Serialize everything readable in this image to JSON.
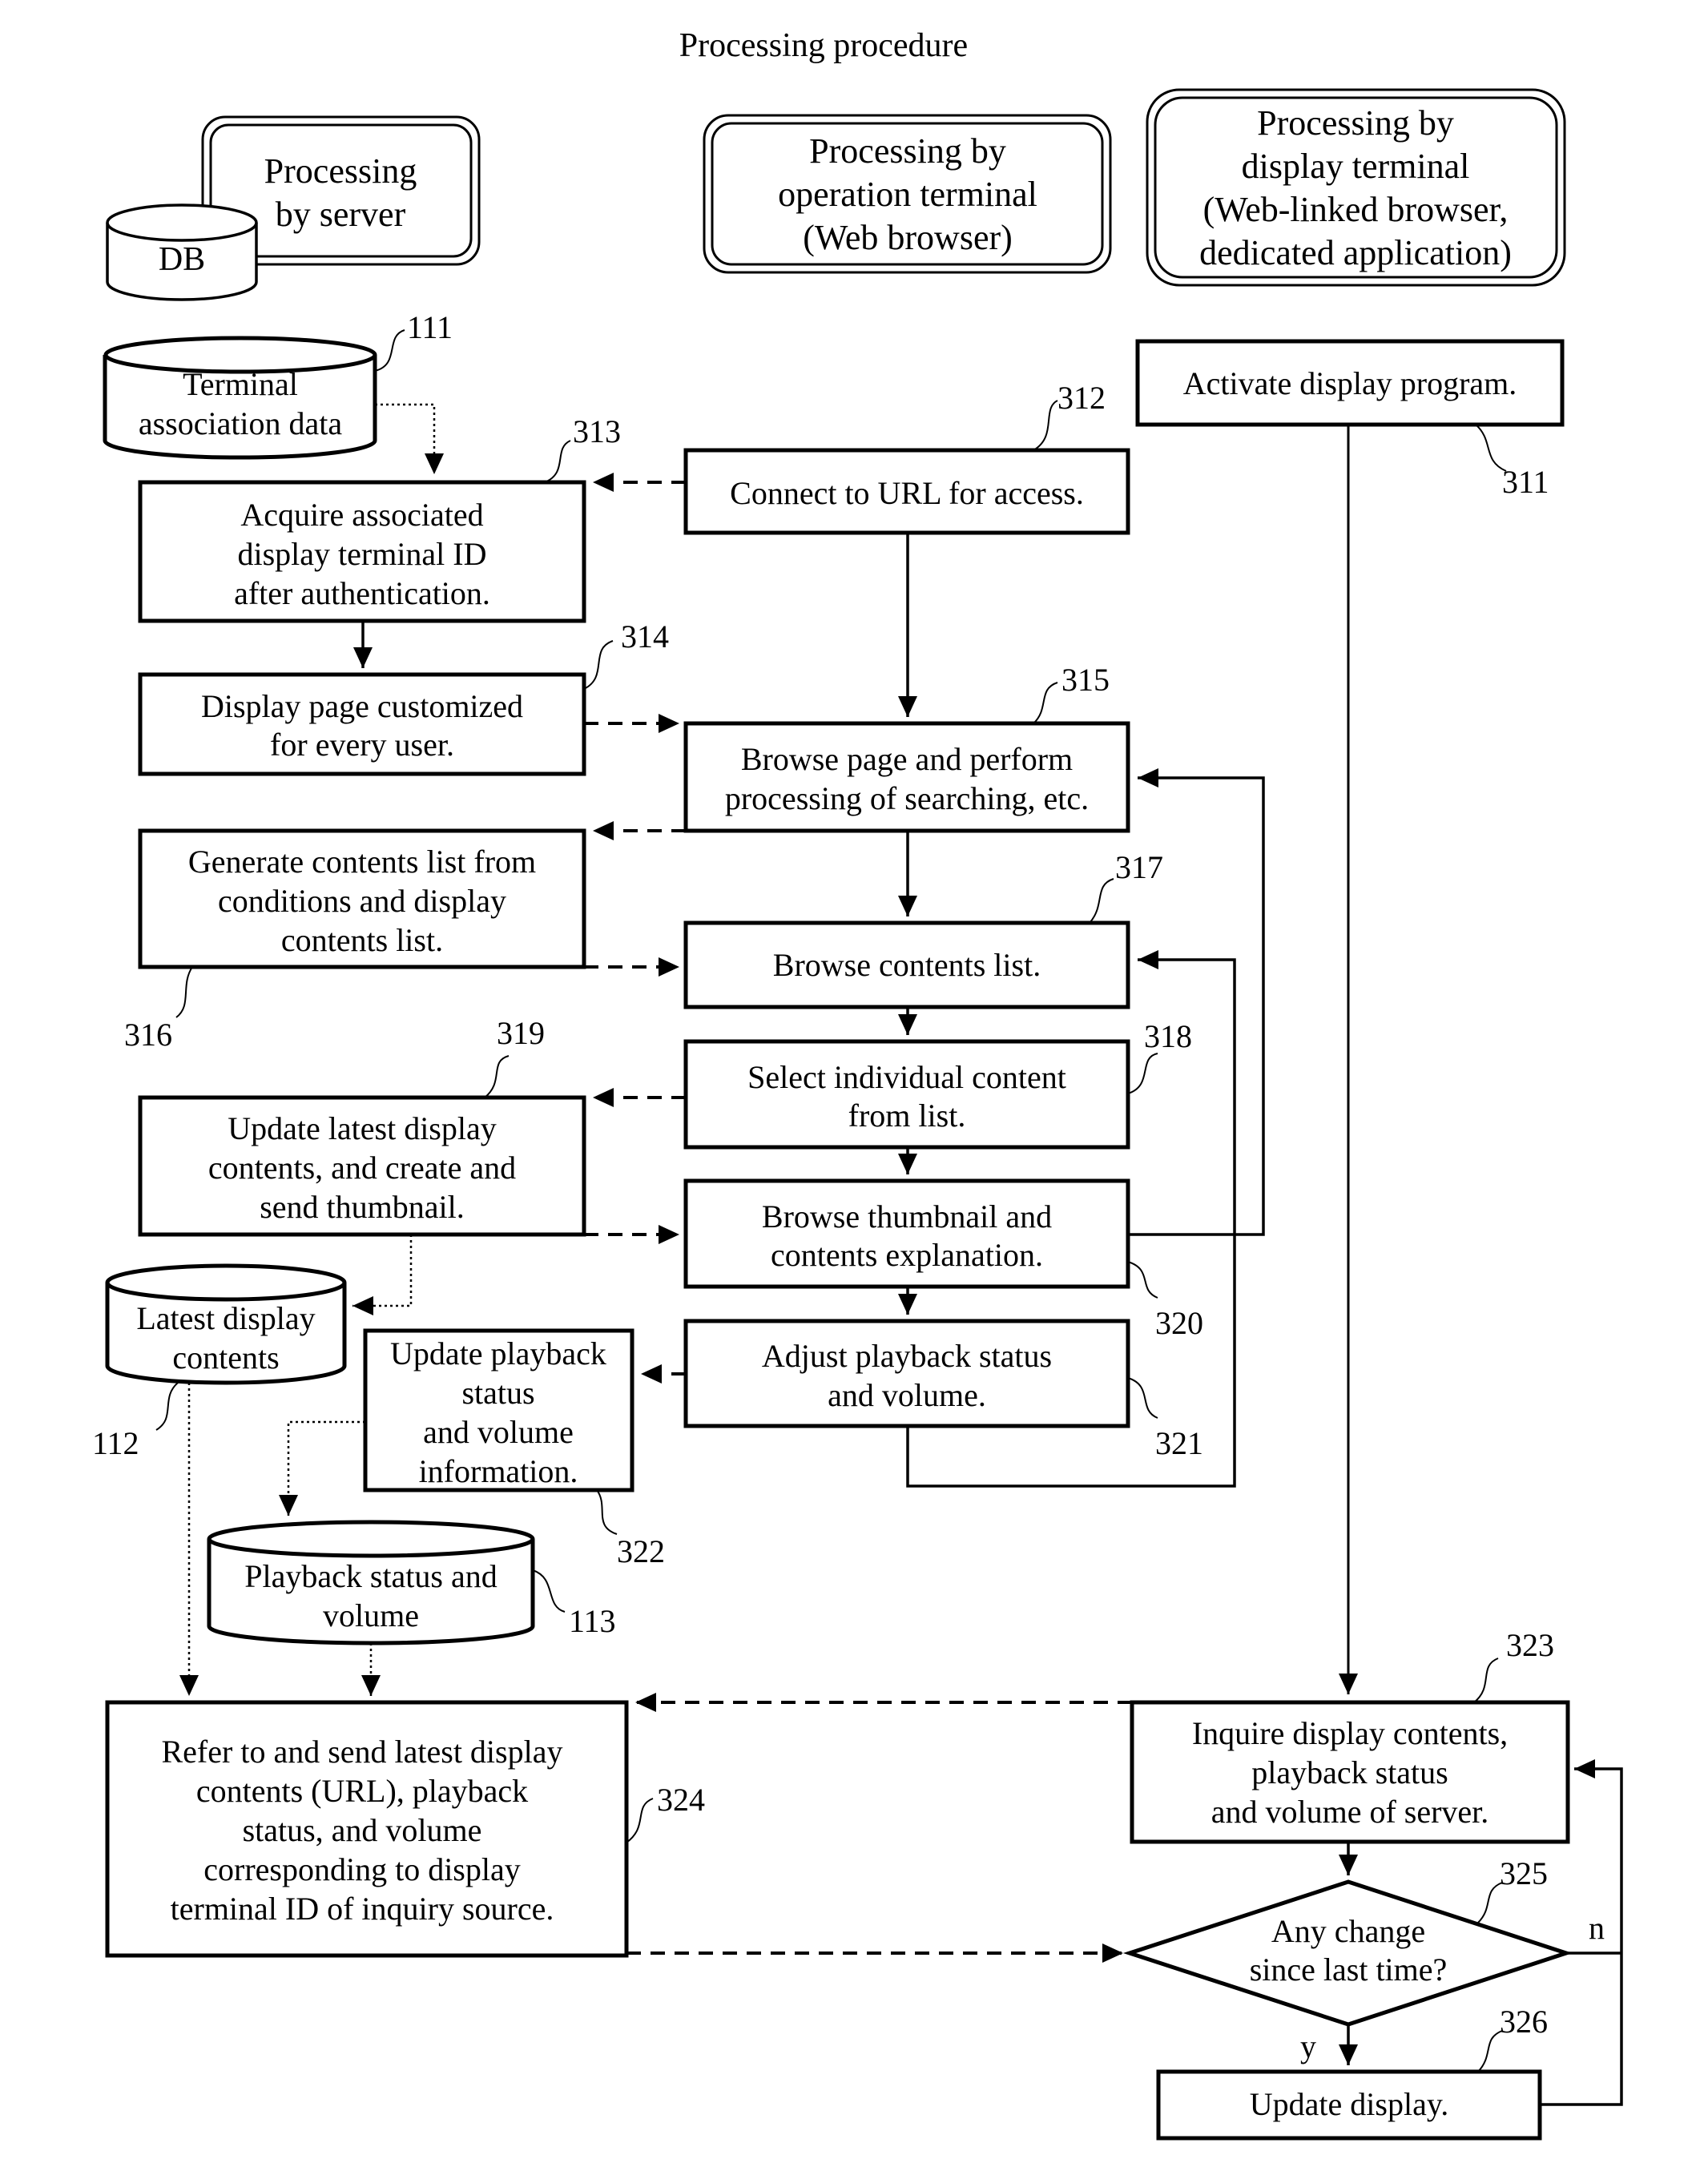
{
  "title": "Processing procedure",
  "lanes": {
    "server": {
      "lines": [
        "Processing",
        "by server"
      ],
      "db_label": "DB"
    },
    "operation": {
      "lines": [
        "Processing by",
        "operation terminal",
        "(Web browser)"
      ]
    },
    "display": {
      "lines": [
        "Processing by",
        "display terminal",
        "(Web-linked browser,",
        "dedicated application)"
      ]
    }
  },
  "databases": {
    "d111": {
      "ref": "111",
      "lines": [
        "Terminal",
        "association data"
      ]
    },
    "d112": {
      "ref": "112",
      "lines": [
        "Latest display",
        "contents"
      ]
    },
    "d113": {
      "ref": "113",
      "lines": [
        "Playback status and",
        "volume"
      ]
    }
  },
  "steps": {
    "s311": {
      "ref": "311",
      "lines": [
        "Activate display program."
      ]
    },
    "s312": {
      "ref": "312",
      "lines": [
        "Connect to URL for access."
      ]
    },
    "s313": {
      "ref": "313",
      "lines": [
        "Acquire associated",
        "display terminal ID",
        "after authentication."
      ]
    },
    "s314": {
      "ref": "314",
      "lines": [
        "Display page customized",
        "for every user."
      ]
    },
    "s315": {
      "ref": "315",
      "lines": [
        "Browse page and perform",
        "processing of searching, etc."
      ]
    },
    "s316": {
      "ref": "316",
      "lines": [
        "Generate contents list from",
        "conditions and display",
        "contents list."
      ]
    },
    "s317": {
      "ref": "317",
      "lines": [
        "Browse contents list."
      ]
    },
    "s318": {
      "ref": "318",
      "lines": [
        "Select individual content",
        "from list."
      ]
    },
    "s319": {
      "ref": "319",
      "lines": [
        "Update latest display",
        "contents, and create and",
        "send thumbnail."
      ]
    },
    "s320": {
      "ref": "320",
      "lines": [
        "Browse thumbnail and",
        "contents explanation."
      ]
    },
    "s321": {
      "ref": "321",
      "lines": [
        "Adjust playback status",
        "and volume."
      ]
    },
    "s322": {
      "ref": "322",
      "lines": [
        "Update playback",
        "status",
        "and volume",
        "information."
      ]
    },
    "s323": {
      "ref": "323",
      "lines": [
        "Inquire display contents,",
        "playback status",
        "and volume of server."
      ]
    },
    "s324": {
      "ref": "324",
      "lines": [
        "Refer to and send latest display",
        "contents (URL), playback",
        "status, and volume",
        "corresponding to display",
        "terminal ID of inquiry source."
      ]
    },
    "s325": {
      "ref": "325",
      "lines": [
        "Any change",
        "since last time?"
      ],
      "yes_label": "y",
      "no_label": "n"
    },
    "s326": {
      "ref": "326",
      "lines": [
        "Update display."
      ]
    }
  }
}
